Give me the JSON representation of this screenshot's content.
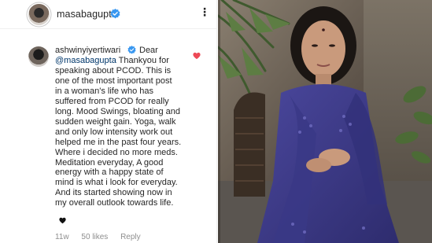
{
  "post": {
    "owner_username": "masabagupta",
    "more_label": "⋮"
  },
  "comment": {
    "username": "ashwinyiyertiwari",
    "first_word": "Dear",
    "mention": "@masabagupta",
    "lines": [
      " Thankyou for",
      "speaking about PCOD. This is",
      "one of the most important post",
      "in a woman's life who has",
      "suffered from PCOD for really",
      "long. Mood Swings, bloating and",
      "sudden weight gain. Yoga, walk",
      "and only low intensity work out",
      "helped me in the past four years.",
      "Where i decided no more meds.",
      "Meditation everyday, A good",
      "energy with a happy state of",
      "mind is what i look for everyday.",
      "And its started showing now in",
      "my overall outlook towards life."
    ],
    "time": "11w",
    "likes": "50 likes",
    "reply_label": "Reply"
  },
  "colors": {
    "verified": "#3897f0",
    "heart": "#ed4956",
    "text": "#262626",
    "muted": "#8e8e8e",
    "outfit": "#3c3a8a"
  }
}
